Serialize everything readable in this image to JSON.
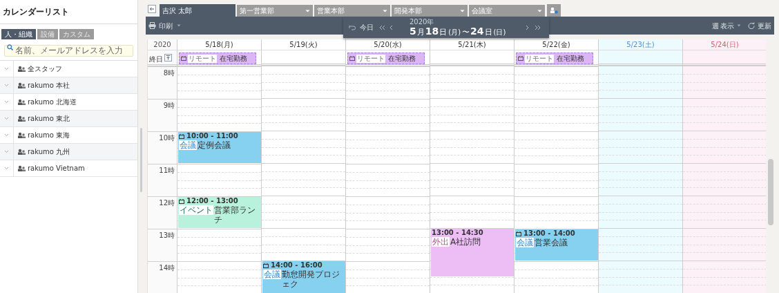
{
  "sidebar": {
    "title": "カレンダーリスト",
    "tabs": [
      {
        "label": "人・組織",
        "selected": true
      },
      {
        "label": "設備",
        "selected": false
      },
      {
        "label": "カスタム",
        "selected": false
      }
    ],
    "search": {
      "placeholder": "名前、メールアドレスを入力"
    },
    "items": [
      {
        "label": "全スタッフ"
      },
      {
        "label": "rakumo 本社"
      },
      {
        "label": "rakumo 北海道"
      },
      {
        "label": "rakumo 東北"
      },
      {
        "label": "rakumo 東海"
      },
      {
        "label": "rakumo 九州"
      },
      {
        "label": "rakumo Vietnam"
      }
    ]
  },
  "calendar_tabs": [
    {
      "label": "吉沢 太郎",
      "kind": "user",
      "selected": true
    },
    {
      "label": "第一営業部",
      "kind": "dropdown",
      "selected": false
    },
    {
      "label": "営業本部",
      "kind": "dropdown",
      "selected": false
    },
    {
      "label": "開発本部",
      "kind": "dropdown",
      "selected": false
    },
    {
      "label": "会議室",
      "kind": "dropdown",
      "selected": false
    }
  ],
  "toolbar": {
    "print": "印刷",
    "today": "今日",
    "year": "2020年",
    "range": [
      {
        "text": "5",
        "kind": "number"
      },
      {
        "text": "月",
        "kind": "unit"
      },
      {
        "text": "18",
        "kind": "number"
      },
      {
        "text": "日",
        "kind": "unit"
      },
      {
        "text": "(月)",
        "kind": "small"
      },
      {
        "text": "〜",
        "kind": "unit"
      },
      {
        "text": "24",
        "kind": "number"
      },
      {
        "text": "日",
        "kind": "unit"
      },
      {
        "text": "(日)",
        "kind": "small"
      }
    ],
    "view": "週",
    "view_label": "表示",
    "refresh": "更新"
  },
  "grid": {
    "year": "2020",
    "all_day_label": "終日",
    "hours": [
      "8時",
      "9時",
      "10時",
      "11時",
      "12時",
      "13時",
      "14時"
    ],
    "days": [
      {
        "label": "5/18(月)",
        "kind": "weekday",
        "all_day": [
          {
            "tag": "リモート",
            "title": "在宅勤務"
          }
        ],
        "events": [
          {
            "time": "10:00 - 11:00",
            "tag": "会議",
            "title": "定例会議",
            "kind": "meeting",
            "has_icon": true
          },
          {
            "time": "12:00 - 13:00",
            "tag": "イベント",
            "title": "営業部ランチ",
            "kind": "event",
            "has_icon": true
          }
        ]
      },
      {
        "label": "5/19(火)",
        "kind": "weekday",
        "events": [
          {
            "time": "14:00 - 16:00",
            "tag": "会議",
            "title": "勤怠開発プロジェク",
            "kind": "meeting",
            "has_icon": true
          }
        ]
      },
      {
        "label": "5/20(水)",
        "kind": "weekday",
        "all_day": [
          {
            "tag": "リモート",
            "title": "在宅勤務"
          }
        ]
      },
      {
        "label": "5/21(木)",
        "kind": "weekday",
        "events": [
          {
            "time": "13:00 - 14:30",
            "tag": "外出",
            "title": "A社訪問",
            "kind": "outing",
            "has_icon": false
          }
        ]
      },
      {
        "label": "5/22(金)",
        "kind": "weekday",
        "all_day": [
          {
            "tag": "リモート",
            "title": "在宅勤務"
          }
        ],
        "events": [
          {
            "time": "13:00 - 14:00",
            "tag": "会議",
            "title": "営業会議",
            "kind": "meeting",
            "has_icon": true
          }
        ]
      },
      {
        "label": "5/23(土)",
        "kind": "saturday"
      },
      {
        "label": "5/24(日)",
        "kind": "sunday"
      }
    ]
  }
}
